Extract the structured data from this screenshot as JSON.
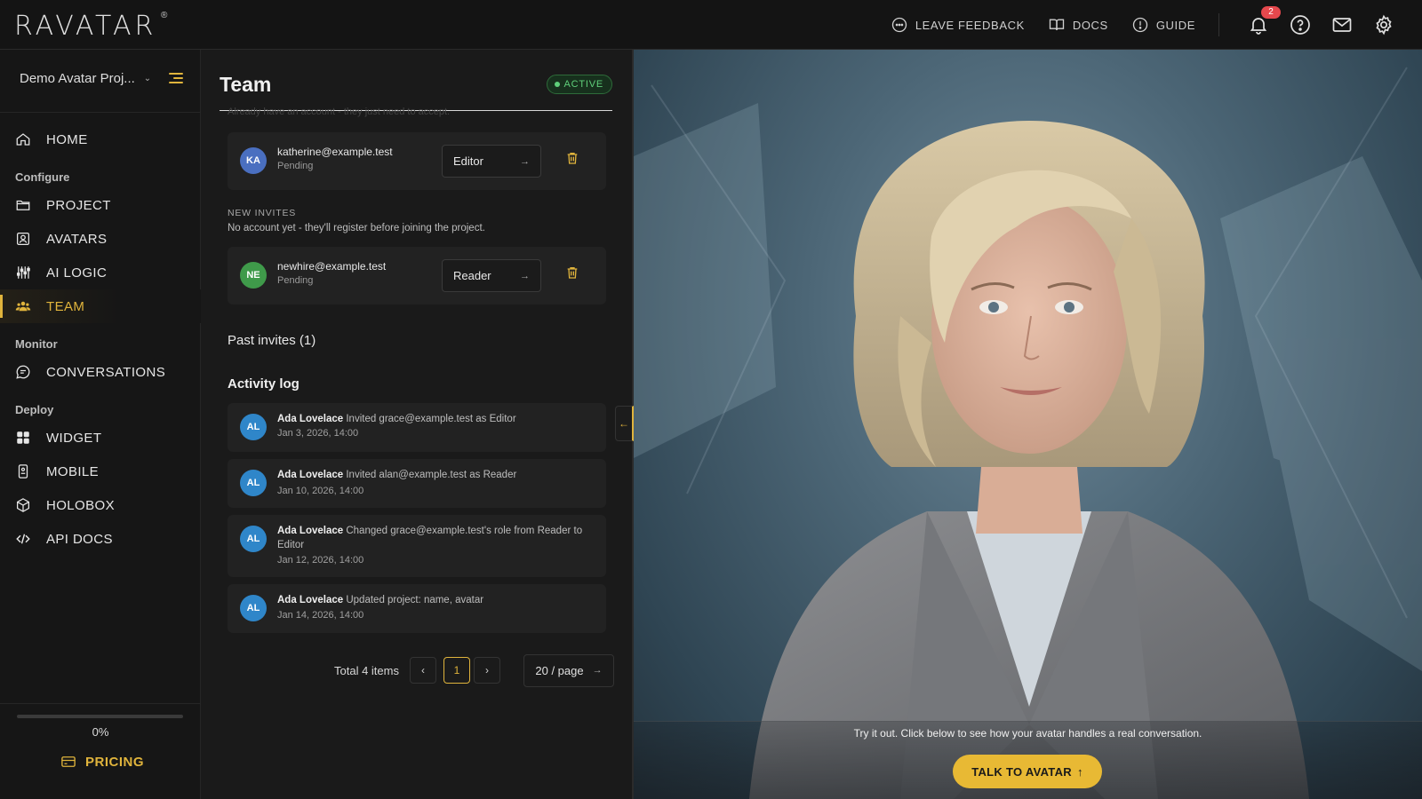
{
  "app": {
    "logo_text": "RAVATAR",
    "logo_mark": "®"
  },
  "topbar": {
    "feedback_label": "LEAVE FEEDBACK",
    "docs_label": "DOCS",
    "guide_label": "GUIDE",
    "notification_count": "2"
  },
  "sidebar": {
    "project_name": "Demo Avatar Proj...",
    "items": [
      {
        "label": "HOME",
        "icon": "home-icon"
      },
      {
        "label": "PROJECT",
        "icon": "folder-icon"
      },
      {
        "label": "AVATARS",
        "icon": "user-card-icon"
      },
      {
        "label": "AI LOGIC",
        "icon": "sliders-icon"
      },
      {
        "label": "TEAM",
        "icon": "team-icon"
      },
      {
        "label": "CONVERSATIONS",
        "icon": "chat-icon"
      },
      {
        "label": "WIDGET",
        "icon": "grid-icon"
      },
      {
        "label": "MOBILE",
        "icon": "mobile-icon"
      },
      {
        "label": "HOLOBOX",
        "icon": "cube-icon"
      },
      {
        "label": "API DOCS",
        "icon": "code-icon"
      }
    ],
    "sections": {
      "configure": "Configure",
      "monitor": "Monitor",
      "deploy": "Deploy"
    },
    "progress_label": "0%",
    "progress_fraction": 0,
    "pricing_label": "PRICING"
  },
  "panel": {
    "title": "Team",
    "status": "ACTIVE",
    "ghost_text": "Already have an account - they just need to accept.",
    "existing_invite": {
      "initials": "KA",
      "email": "katherine@example.test",
      "status": "Pending",
      "role": "Editor"
    },
    "new_invites_label": "NEW INVITES",
    "new_invites_sub": "No account yet - they'll register before joining the project.",
    "new_invite": {
      "initials": "NE",
      "email": "newhire@example.test",
      "status": "Pending",
      "role": "Reader"
    },
    "past_invites": "Past invites (1)",
    "activity_title": "Activity log",
    "activity": [
      {
        "initials": "AL",
        "actor": "Ada Lovelace",
        "action": "Invited grace@example.test as Editor",
        "date": "Jan 3, 2026, 14:00"
      },
      {
        "initials": "AL",
        "actor": "Ada Lovelace",
        "action": "Invited alan@example.test as Reader",
        "date": "Jan 10, 2026, 14:00"
      },
      {
        "initials": "AL",
        "actor": "Ada Lovelace",
        "action": "Changed grace@example.test's role from Reader to Editor",
        "date": "Jan 12, 2026, 14:00"
      },
      {
        "initials": "AL",
        "actor": "Ada Lovelace",
        "action": "Updated project: name, avatar",
        "date": "Jan 14, 2026, 14:00"
      }
    ],
    "pagination": {
      "total": "Total 4 items",
      "current_page": "1",
      "per_page": "20 / page"
    }
  },
  "preview": {
    "hint": "Try it out. Click below to see how your avatar handles a real conversation.",
    "talk_button": "TALK TO AVATAR"
  },
  "colors": {
    "accent": "#e0b43c",
    "background": "#141414",
    "active_green": "#5fcf7a",
    "danger": "#e5484d"
  }
}
